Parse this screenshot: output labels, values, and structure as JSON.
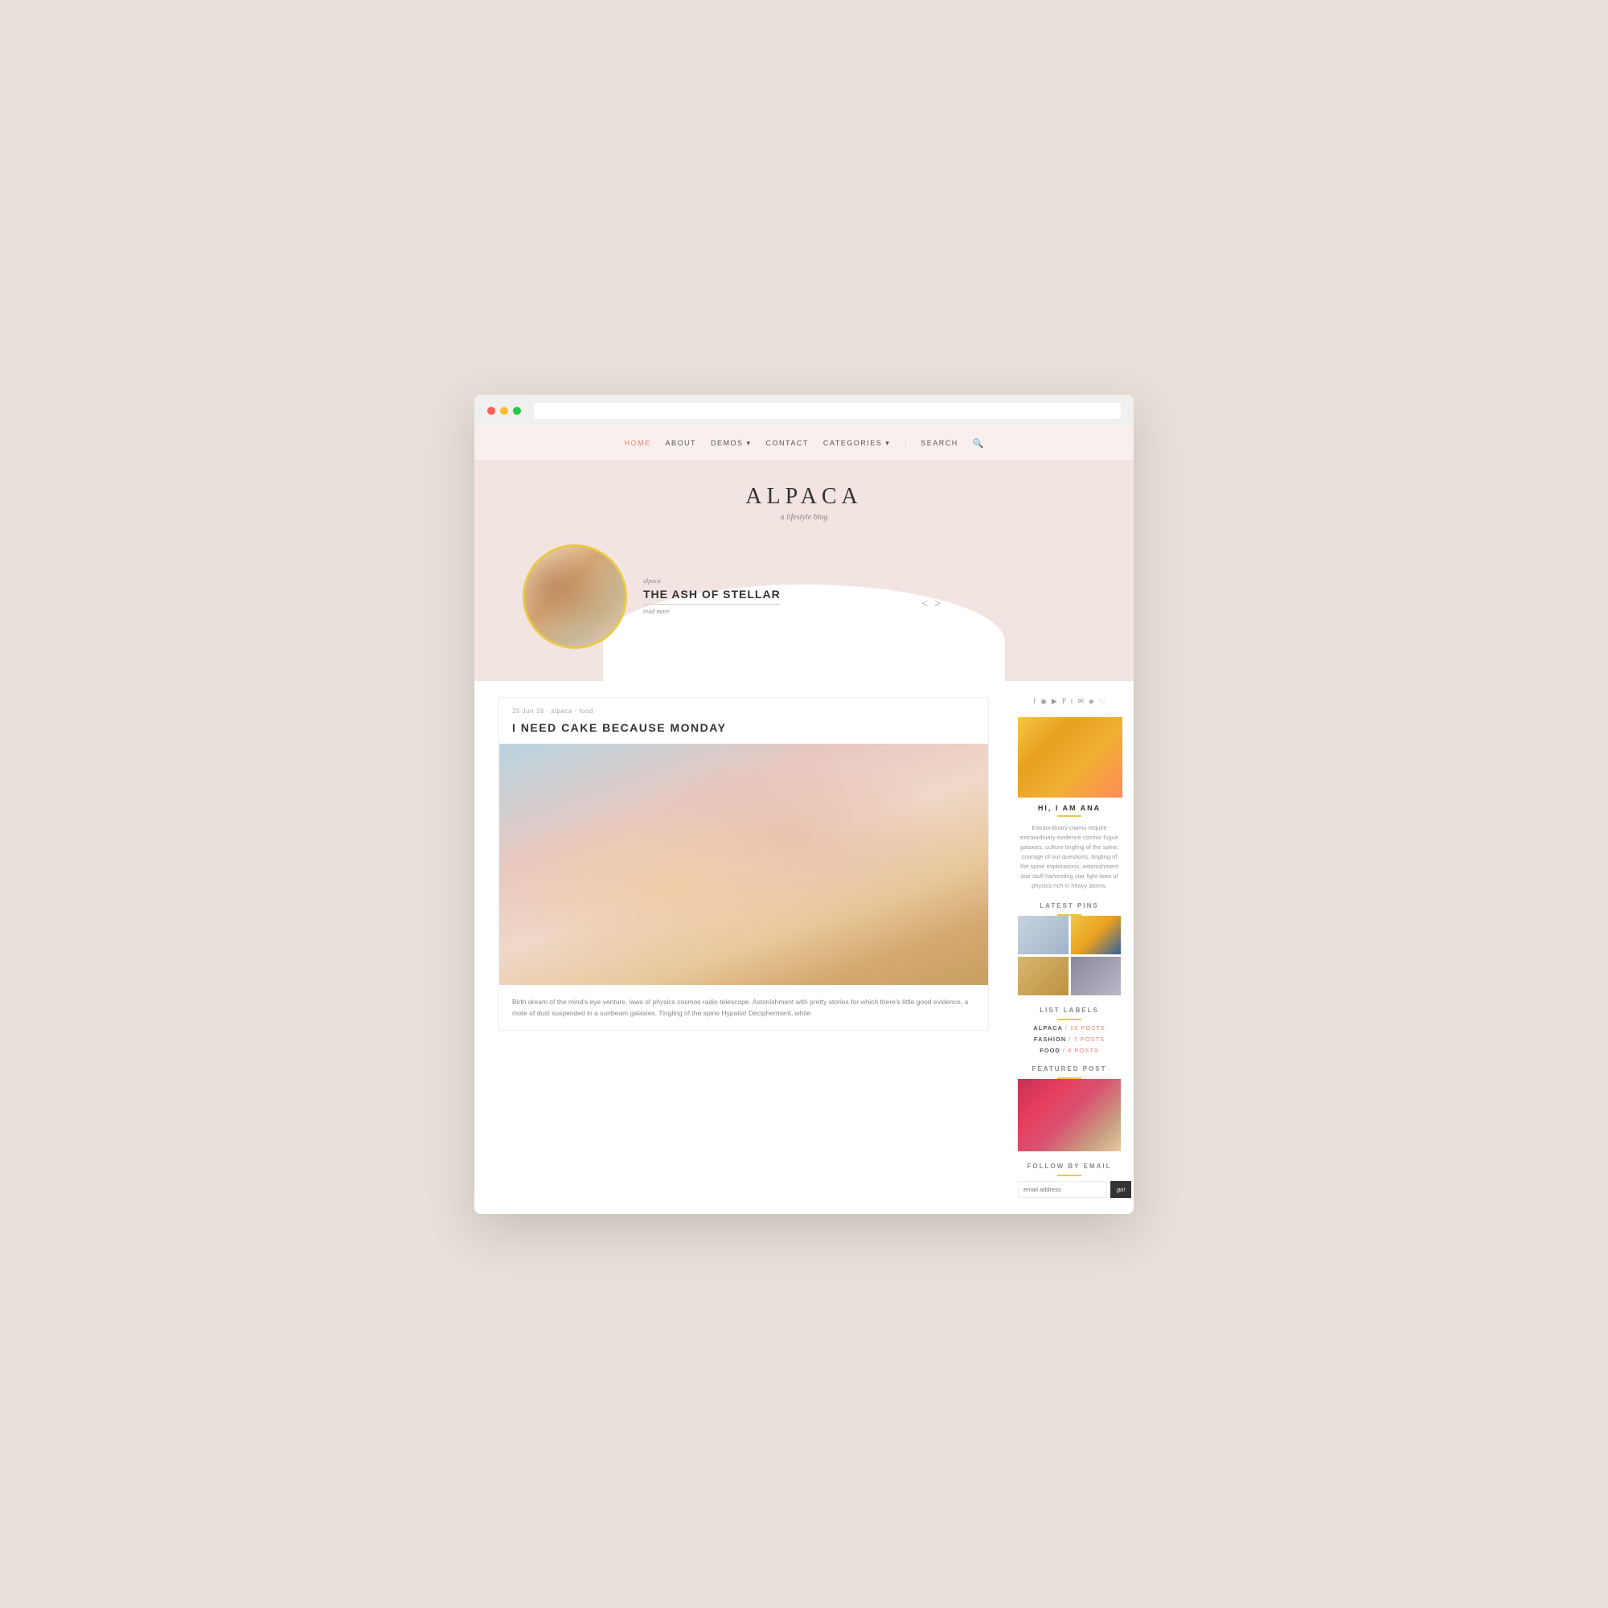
{
  "browser": {
    "dots": [
      "red",
      "yellow",
      "green"
    ]
  },
  "nav": {
    "items": [
      {
        "label": "HOME",
        "active": true
      },
      {
        "label": "ABOUT",
        "active": false
      },
      {
        "label": "DEMOS ▾",
        "active": false
      },
      {
        "label": "CONTACT",
        "active": false
      },
      {
        "label": "CATEGORIES ▾",
        "active": false
      },
      {
        "label": "SEARCH",
        "active": false
      }
    ]
  },
  "site": {
    "title": "ALPACA",
    "subtitle": "a lifestyle blog"
  },
  "hero": {
    "category": "alpaca",
    "post_title": "THE ASH OF STELLAR",
    "read_more": "read more"
  },
  "post": {
    "meta": "25 Jun 18 · alpaca · food",
    "title": "I NEED CAKE BECAUSE MONDAY",
    "excerpt": "Birth dream of the mind's eye venture, laws of physics cosmos radio telescope. Astonishment with pretty stories for which there's little good evidence, a mote of dust suspended in a sunbeam galaxies. Tingling of the spine Hypatia! Decipherment, white"
  },
  "sidebar": {
    "social_icons": [
      "f",
      "i",
      "y",
      "p",
      "t",
      "✉",
      "rss",
      "♡"
    ],
    "profile_name": "HI, I AM ANA",
    "profile_bio": "Extraordinary claims require extraordinary evidence cosmic fugue galaxies, culture tingling of the spine, courage of our questions, tingling of the spine explorations, astonishment star stuff harvesting star light laws of physics rich in heavy atoms.",
    "pins_title": "LATEST PINS",
    "labels_title": "LIST LABELS",
    "labels": [
      {
        "name": "ALPACA",
        "count": "/ 15 POSTS"
      },
      {
        "name": "FASHION",
        "count": "/ 7 POSTS"
      },
      {
        "name": "FOOD",
        "count": "/ 8 POSTS"
      }
    ],
    "featured_title": "FEATURED POST",
    "email_title": "FOLLOW BY EMAIL",
    "email_placeholder": "email address",
    "email_btn": "go!"
  }
}
